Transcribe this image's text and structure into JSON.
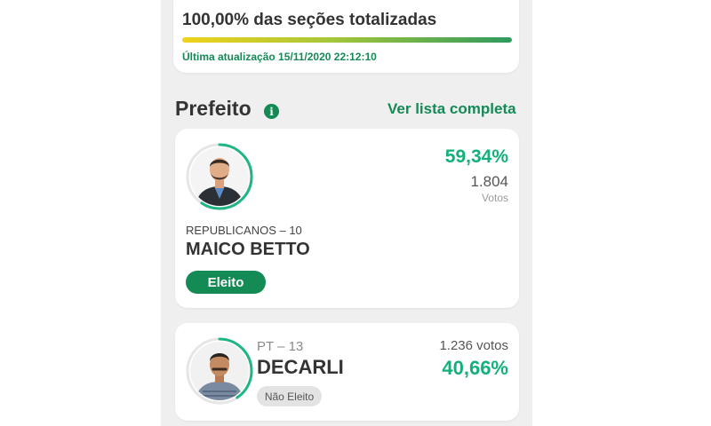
{
  "progress": {
    "title": "100,00% das seções totalizadas",
    "percent": 100,
    "updated": "Última atualização 15/11/2020 22:12:10"
  },
  "section": {
    "title": "Prefeito",
    "info_icon": "i",
    "list_link": "Ver lista completa"
  },
  "candidates": [
    {
      "party": "REPUBLICANOS – 10",
      "name": "MAICO BETTO",
      "percent": "59,34%",
      "percent_value": 59.34,
      "votes": "1.804",
      "votes_label": "Votos",
      "status": "Eleito"
    },
    {
      "party": "PT – 13",
      "name": "DECARLI",
      "percent": "40,66%",
      "percent_value": 40.66,
      "votes": "1.236 votos",
      "status": "Não Eleito"
    }
  ],
  "colors": {
    "accent": "#148a55",
    "percent": "#14b07a",
    "ring": "#1fb684"
  }
}
